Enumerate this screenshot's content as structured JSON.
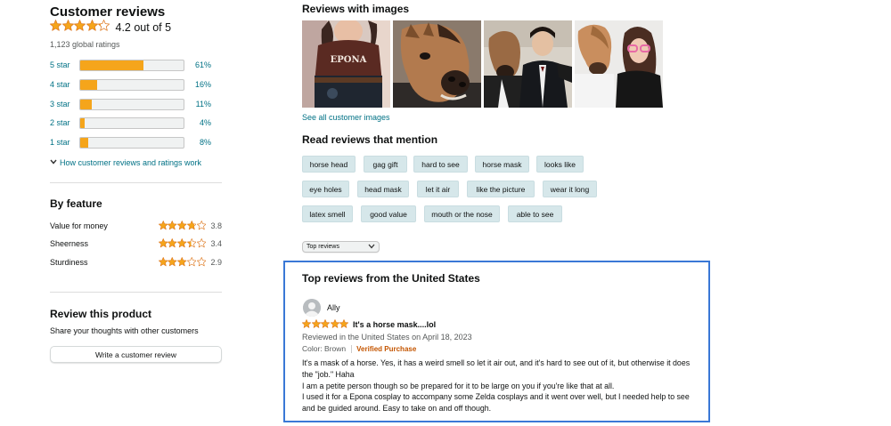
{
  "summary": {
    "title": "Customer reviews",
    "average_text": "4.2 out of 5",
    "average_rating": 4.2,
    "global_ratings": "1,123 global ratings",
    "histogram": [
      {
        "label": "5 star",
        "percent_text": "61%",
        "percent": 61
      },
      {
        "label": "4 star",
        "percent_text": "16%",
        "percent": 16
      },
      {
        "label": "3 star",
        "percent_text": "11%",
        "percent": 11
      },
      {
        "label": "2 star",
        "percent_text": "4%",
        "percent": 4
      },
      {
        "label": "1 star",
        "percent_text": "8%",
        "percent": 8
      }
    ],
    "how_link": "How customer reviews and ratings work"
  },
  "by_feature": {
    "title": "By feature",
    "features": [
      {
        "name": "Value for money",
        "value": "3.8",
        "rating": 3.8
      },
      {
        "name": "Sheerness",
        "value": "3.4",
        "rating": 3.4
      },
      {
        "name": "Sturdiness",
        "value": "2.9",
        "rating": 2.9
      }
    ]
  },
  "review_product": {
    "title": "Review this product",
    "subtitle": "Share your thoughts with other customers",
    "button": "Write a customer review"
  },
  "images_section": {
    "title": "Reviews with images",
    "see_all": "See all customer images"
  },
  "mentions": {
    "title": "Read reviews that mention",
    "rows": [
      [
        "horse head",
        "gag gift",
        "hard to see",
        "horse mask",
        "looks like"
      ],
      [
        "eye holes",
        "head mask",
        "let it air",
        "like the picture",
        "wear it long"
      ],
      [
        "latex smell",
        "good value",
        "mouth or the nose",
        "able to see"
      ]
    ]
  },
  "sort": {
    "selected": "Top reviews"
  },
  "top_reviews": {
    "title": "Top reviews from the United States",
    "review": {
      "author": "Ally",
      "rating": 5,
      "headline": "It's a horse mask....lol",
      "date_line": "Reviewed in the United States on April 18, 2023",
      "color": "Color: Brown",
      "verified": "Verified Purchase",
      "body": [
        "It's a mask of a horse. Yes, it has a weird smell so let it air out, and it's hard to see out of it, but otherwise it does the \"job.\" Haha",
        "I am a petite person though so be prepared for it to be large on you if you're like that at all.",
        "I used it for a Epona cosplay to accompany some Zelda cosplays and it went over well, but I needed help to see and be guided around. Easy to take on and off though."
      ]
    }
  },
  "photo_text": {
    "shirt": "EPONA"
  },
  "colors": {
    "star": "#F5A51B",
    "link": "#007185",
    "chip_bg": "#D6E7EA",
    "verified": "#C45500",
    "highlight_border": "#3A78D6"
  }
}
